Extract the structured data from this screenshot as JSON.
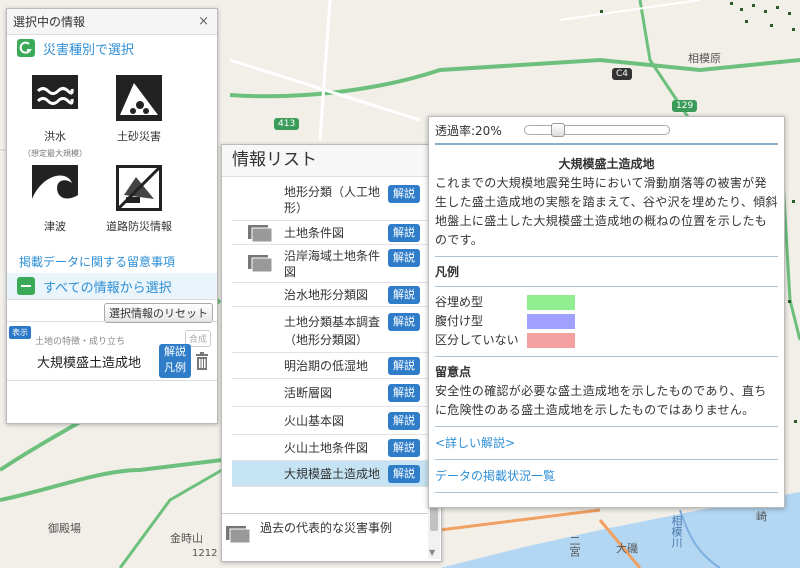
{
  "map": {
    "labels": {
      "sagamihara": "相模原",
      "c4": "C4",
      "r129": "129",
      "r413": "413",
      "gotemba": "御殿場",
      "kintokiyama": "金時山",
      "kintoki_elev": "1212",
      "sagamigawa": "相模川",
      "daiiso": "大磯",
      "ninomiya": "二宮",
      "saki": "崎"
    },
    "colors": {
      "background": "#f2efe9",
      "road_green": "#3b9b5a",
      "sea": "#b3d7f2"
    }
  },
  "left_panel": {
    "title": "選択中の情報",
    "close": "×",
    "by_disaster_type": "災害種別で選択",
    "hazards": [
      {
        "label": "洪水",
        "sub": "（想定最大規模）"
      },
      {
        "label": "土砂災害",
        "sub": ""
      },
      {
        "label": "津波",
        "sub": ""
      },
      {
        "label": "道路防災情報",
        "sub": ""
      }
    ],
    "notes_link": "掲載データに関する留意事項",
    "select_all": "すべての情報から選択",
    "reset_button": "選択情報のリセット",
    "selected": {
      "badge": "表示",
      "category": "土地の特徴・成り立ち",
      "name": "大規模盛土造成地",
      "combine": "合成",
      "kaisetsu": "解説",
      "hanrei": "凡例"
    }
  },
  "info_list": {
    "title": "情報リスト",
    "rows": [
      {
        "label": "地形分類（人工地形）",
        "button": "解説",
        "folder": false
      },
      {
        "label": "土地条件図",
        "button": "解説",
        "folder": true
      },
      {
        "label": "沿岸海域土地条件図",
        "button": "解説",
        "folder": true
      },
      {
        "label": "治水地形分類図",
        "button": "解説",
        "folder": false
      },
      {
        "label": "土地分類基本調査（地形分類図）",
        "button": "解説",
        "folder": false
      },
      {
        "label": "明治期の低湿地",
        "button": "解説",
        "folder": false
      },
      {
        "label": "活断層図",
        "button": "解説",
        "folder": false
      },
      {
        "label": "火山基本図",
        "button": "解説",
        "folder": false
      },
      {
        "label": "火山土地条件図",
        "button": "解説",
        "folder": false
      },
      {
        "label": "大規模盛土造成地",
        "button": "解説",
        "folder": false
      }
    ],
    "past_disasters": "過去の代表的な災害事例"
  },
  "detail": {
    "opacity_label": "透過率:20%",
    "opacity_value": 0.2,
    "title": "大規模盛土造成地",
    "description": "これまでの大規模地震発生時において滑動崩落等の被害が発生した盛土造成地の実態を踏まえて、谷や沢を埋めたり、傾斜地盤上に盛土した大規模盛土造成地の概ねの位置を示したものです。",
    "legend_head": "凡例",
    "legend": [
      {
        "label": "谷埋め型",
        "color": "#90ee90"
      },
      {
        "label": "腹付け型",
        "color": "#a0a0ff"
      },
      {
        "label": "区分していない",
        "color": "#f4a0a0"
      }
    ],
    "notes_head": "留意点",
    "notes": "安全性の確認が必要な盛土造成地を示したものであり、直ちに危険性のある盛土造成地を示したものではありません。",
    "detail_link": "<詳しい解説>",
    "status_link": "データの掲載状況一覧"
  }
}
